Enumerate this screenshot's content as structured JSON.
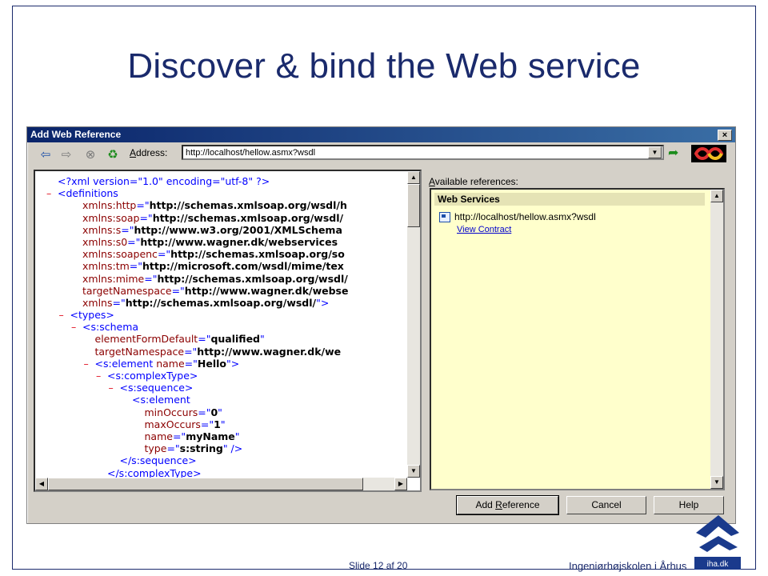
{
  "slide": {
    "title": "Discover & bind the Web service",
    "slide_number": "Slide 12 af  20",
    "school": "Ingeniørhøjskolen i Århus",
    "logo_text": "iha.dk"
  },
  "dialog": {
    "title": "Add Web Reference",
    "close": "×",
    "address_label_prefix": "",
    "address_label_u": "A",
    "address_label_rest": "ddress:",
    "address_value": "http://localhost/hellow.asmx?wsdl",
    "toolbar_icons": [
      "back-icon",
      "forward-icon",
      "stop-icon",
      "refresh-icon",
      "go-icon"
    ]
  },
  "xml_lines": [
    {
      "indent": 0,
      "marker": "",
      "parts": [
        [
          "tag",
          "<?xml version=\"1.0\" encoding=\"utf-8\" ?>"
        ]
      ]
    },
    {
      "indent": 0,
      "marker": "–",
      "parts": [
        [
          "tag",
          "<definitions"
        ]
      ]
    },
    {
      "indent": 2,
      "marker": "",
      "parts": [
        [
          "attr",
          "xmlns:http"
        ],
        [
          "tag",
          "=\""
        ],
        [
          "val",
          "http://schemas.xmlsoap.org/wsdl/h"
        ]
      ]
    },
    {
      "indent": 2,
      "marker": "",
      "parts": [
        [
          "attr",
          "xmlns:soap"
        ],
        [
          "tag",
          "=\""
        ],
        [
          "val",
          "http://schemas.xmlsoap.org/wsdl/"
        ]
      ]
    },
    {
      "indent": 2,
      "marker": "",
      "parts": [
        [
          "attr",
          "xmlns:s"
        ],
        [
          "tag",
          "=\""
        ],
        [
          "val",
          "http://www.w3.org/2001/XMLSchema"
        ]
      ]
    },
    {
      "indent": 2,
      "marker": "",
      "parts": [
        [
          "attr",
          "xmlns:s0"
        ],
        [
          "tag",
          "=\""
        ],
        [
          "val",
          "http://www.wagner.dk/webservices"
        ]
      ]
    },
    {
      "indent": 2,
      "marker": "",
      "parts": [
        [
          "attr",
          "xmlns:soapenc"
        ],
        [
          "tag",
          "=\""
        ],
        [
          "val",
          "http://schemas.xmlsoap.org/so"
        ]
      ]
    },
    {
      "indent": 2,
      "marker": "",
      "parts": [
        [
          "attr",
          "xmlns:tm"
        ],
        [
          "tag",
          "=\""
        ],
        [
          "val",
          "http://microsoft.com/wsdl/mime/tex"
        ]
      ]
    },
    {
      "indent": 2,
      "marker": "",
      "parts": [
        [
          "attr",
          "xmlns:mime"
        ],
        [
          "tag",
          "=\""
        ],
        [
          "val",
          "http://schemas.xmlsoap.org/wsdl/"
        ]
      ]
    },
    {
      "indent": 2,
      "marker": "",
      "parts": [
        [
          "attr",
          "targetNamespace"
        ],
        [
          "tag",
          "=\""
        ],
        [
          "val",
          "http://www.wagner.dk/webse"
        ]
      ]
    },
    {
      "indent": 2,
      "marker": "",
      "parts": [
        [
          "attr",
          "xmlns"
        ],
        [
          "tag",
          "=\""
        ],
        [
          "val",
          "http://schemas.xmlsoap.org/wsdl/"
        ],
        [
          "tag",
          "\">"
        ]
      ]
    },
    {
      "indent": 1,
      "marker": "–",
      "parts": [
        [
          "tag",
          "<types>"
        ]
      ]
    },
    {
      "indent": 2,
      "marker": "–",
      "parts": [
        [
          "tag",
          "<s:schema"
        ]
      ]
    },
    {
      "indent": 3,
      "marker": "",
      "parts": [
        [
          "attr",
          "elementFormDefault"
        ],
        [
          "tag",
          "=\""
        ],
        [
          "val",
          "qualified"
        ],
        [
          "tag",
          "\""
        ]
      ]
    },
    {
      "indent": 3,
      "marker": "",
      "parts": [
        [
          "attr",
          "targetNamespace"
        ],
        [
          "tag",
          "=\""
        ],
        [
          "val",
          "http://www.wagner.dk/we"
        ]
      ]
    },
    {
      "indent": 3,
      "marker": "–",
      "parts": [
        [
          "tag",
          "<s:element "
        ],
        [
          "attr",
          "name"
        ],
        [
          "tag",
          "=\""
        ],
        [
          "val",
          "Hello"
        ],
        [
          "tag",
          "\">"
        ]
      ]
    },
    {
      "indent": 4,
      "marker": "–",
      "parts": [
        [
          "tag",
          "<s:complexType>"
        ]
      ]
    },
    {
      "indent": 5,
      "marker": "–",
      "parts": [
        [
          "tag",
          "<s:sequence>"
        ]
      ]
    },
    {
      "indent": 6,
      "marker": "",
      "parts": [
        [
          "tag",
          "<s:element"
        ]
      ]
    },
    {
      "indent": 7,
      "marker": "",
      "parts": [
        [
          "attr",
          "minOccurs"
        ],
        [
          "tag",
          "=\""
        ],
        [
          "val",
          "0"
        ],
        [
          "tag",
          "\""
        ]
      ]
    },
    {
      "indent": 7,
      "marker": "",
      "parts": [
        [
          "attr",
          "maxOccurs"
        ],
        [
          "tag",
          "=\""
        ],
        [
          "val",
          "1"
        ],
        [
          "tag",
          "\""
        ]
      ]
    },
    {
      "indent": 7,
      "marker": "",
      "parts": [
        [
          "attr",
          "name"
        ],
        [
          "tag",
          "=\""
        ],
        [
          "val",
          "myName"
        ],
        [
          "tag",
          "\""
        ]
      ]
    },
    {
      "indent": 7,
      "marker": "",
      "parts": [
        [
          "attr",
          "type"
        ],
        [
          "tag",
          "=\""
        ],
        [
          "val",
          "s:string"
        ],
        [
          "tag",
          "\" />"
        ]
      ]
    },
    {
      "indent": 5,
      "marker": "",
      "parts": [
        [
          "tag",
          "</s:sequence>"
        ]
      ]
    },
    {
      "indent": 4,
      "marker": "",
      "parts": [
        [
          "tag",
          "</s:complexType>"
        ]
      ]
    }
  ],
  "references": {
    "label_u": "A",
    "label_rest": "vailable references:",
    "header": "Web Services",
    "item_url": "http://localhost/hellow.asmx?wsdl",
    "view_contract": "View Contract"
  },
  "buttons": {
    "add_reference_pre": "Add ",
    "add_reference_u": "R",
    "add_reference_post": "eference",
    "cancel": "Cancel",
    "help": "Help"
  }
}
